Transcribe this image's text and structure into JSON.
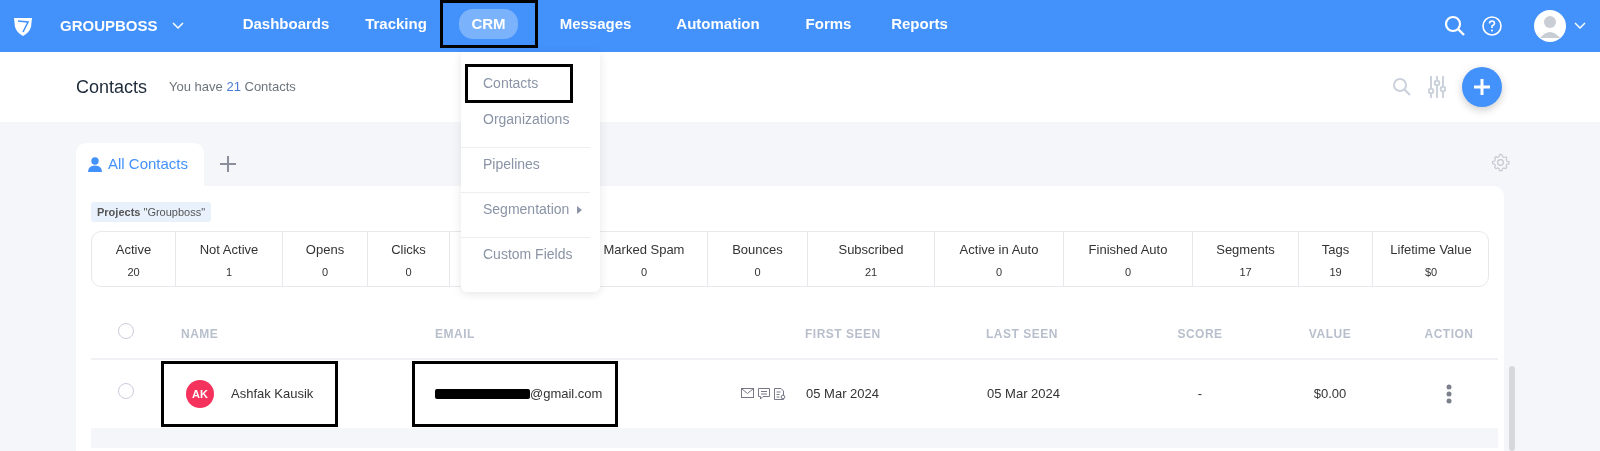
{
  "brand": {
    "name": "GROUPBOSS"
  },
  "nav": [
    {
      "label": "Dashboards",
      "selected": false,
      "highlighted": false
    },
    {
      "label": "Tracking",
      "selected": false,
      "highlighted": false
    },
    {
      "label": "CRM",
      "selected": true,
      "highlighted": true
    },
    {
      "label": "Messages",
      "selected": false,
      "highlighted": false
    },
    {
      "label": "Automation",
      "selected": false,
      "highlighted": false
    },
    {
      "label": "Forms",
      "selected": false,
      "highlighted": false
    },
    {
      "label": "Reports",
      "selected": false,
      "highlighted": false
    }
  ],
  "crm_menu": [
    {
      "label": "Contacts",
      "highlighted": true,
      "submenu": false
    },
    {
      "label": "Organizations",
      "highlighted": false,
      "submenu": false
    },
    {
      "label": "Pipelines",
      "highlighted": false,
      "submenu": false
    },
    {
      "label": "Segmentation",
      "highlighted": false,
      "submenu": true
    },
    {
      "label": "Custom Fields",
      "highlighted": false,
      "submenu": false
    }
  ],
  "header": {
    "title": "Contacts",
    "count_prefix": "You have",
    "count": "21",
    "count_suffix": "Contacts"
  },
  "tabs": [
    {
      "label": "All Contacts",
      "selected": true
    }
  ],
  "filter_tag": {
    "key": "Projects",
    "value": "\"Groupboss\""
  },
  "stats": [
    {
      "label": "Active",
      "value": "20"
    },
    {
      "label": "Not Active",
      "value": "1"
    },
    {
      "label": "Opens",
      "value": "0"
    },
    {
      "label": "Clicks",
      "value": "0"
    },
    {
      "label": "Marked Spam",
      "value": "0"
    },
    {
      "label": "Bounces",
      "value": "0"
    },
    {
      "label": "Subscribed",
      "value": "21"
    },
    {
      "label": "Active in Auto",
      "value": "0"
    },
    {
      "label": "Finished Auto",
      "value": "0"
    },
    {
      "label": "Segments",
      "value": "17"
    },
    {
      "label": "Tags",
      "value": "19"
    },
    {
      "label": "Lifetime Value",
      "value": "$0"
    }
  ],
  "table": {
    "select_all_checked": false,
    "columns": [
      "NAME",
      "EMAIL",
      "FIRST SEEN",
      "LAST SEEN",
      "SCORE",
      "VALUE",
      "ACTION"
    ],
    "rows": [
      {
        "checked": false,
        "initials": "AK",
        "name": "Ashfak Kausik",
        "name_highlighted": true,
        "email": "@gmail.com",
        "email_redacted": true,
        "email_highlighted": true,
        "first_seen": "05 Mar 2024",
        "last_seen": "05 Mar 2024",
        "score": "-",
        "value": "$0.00"
      }
    ]
  }
}
